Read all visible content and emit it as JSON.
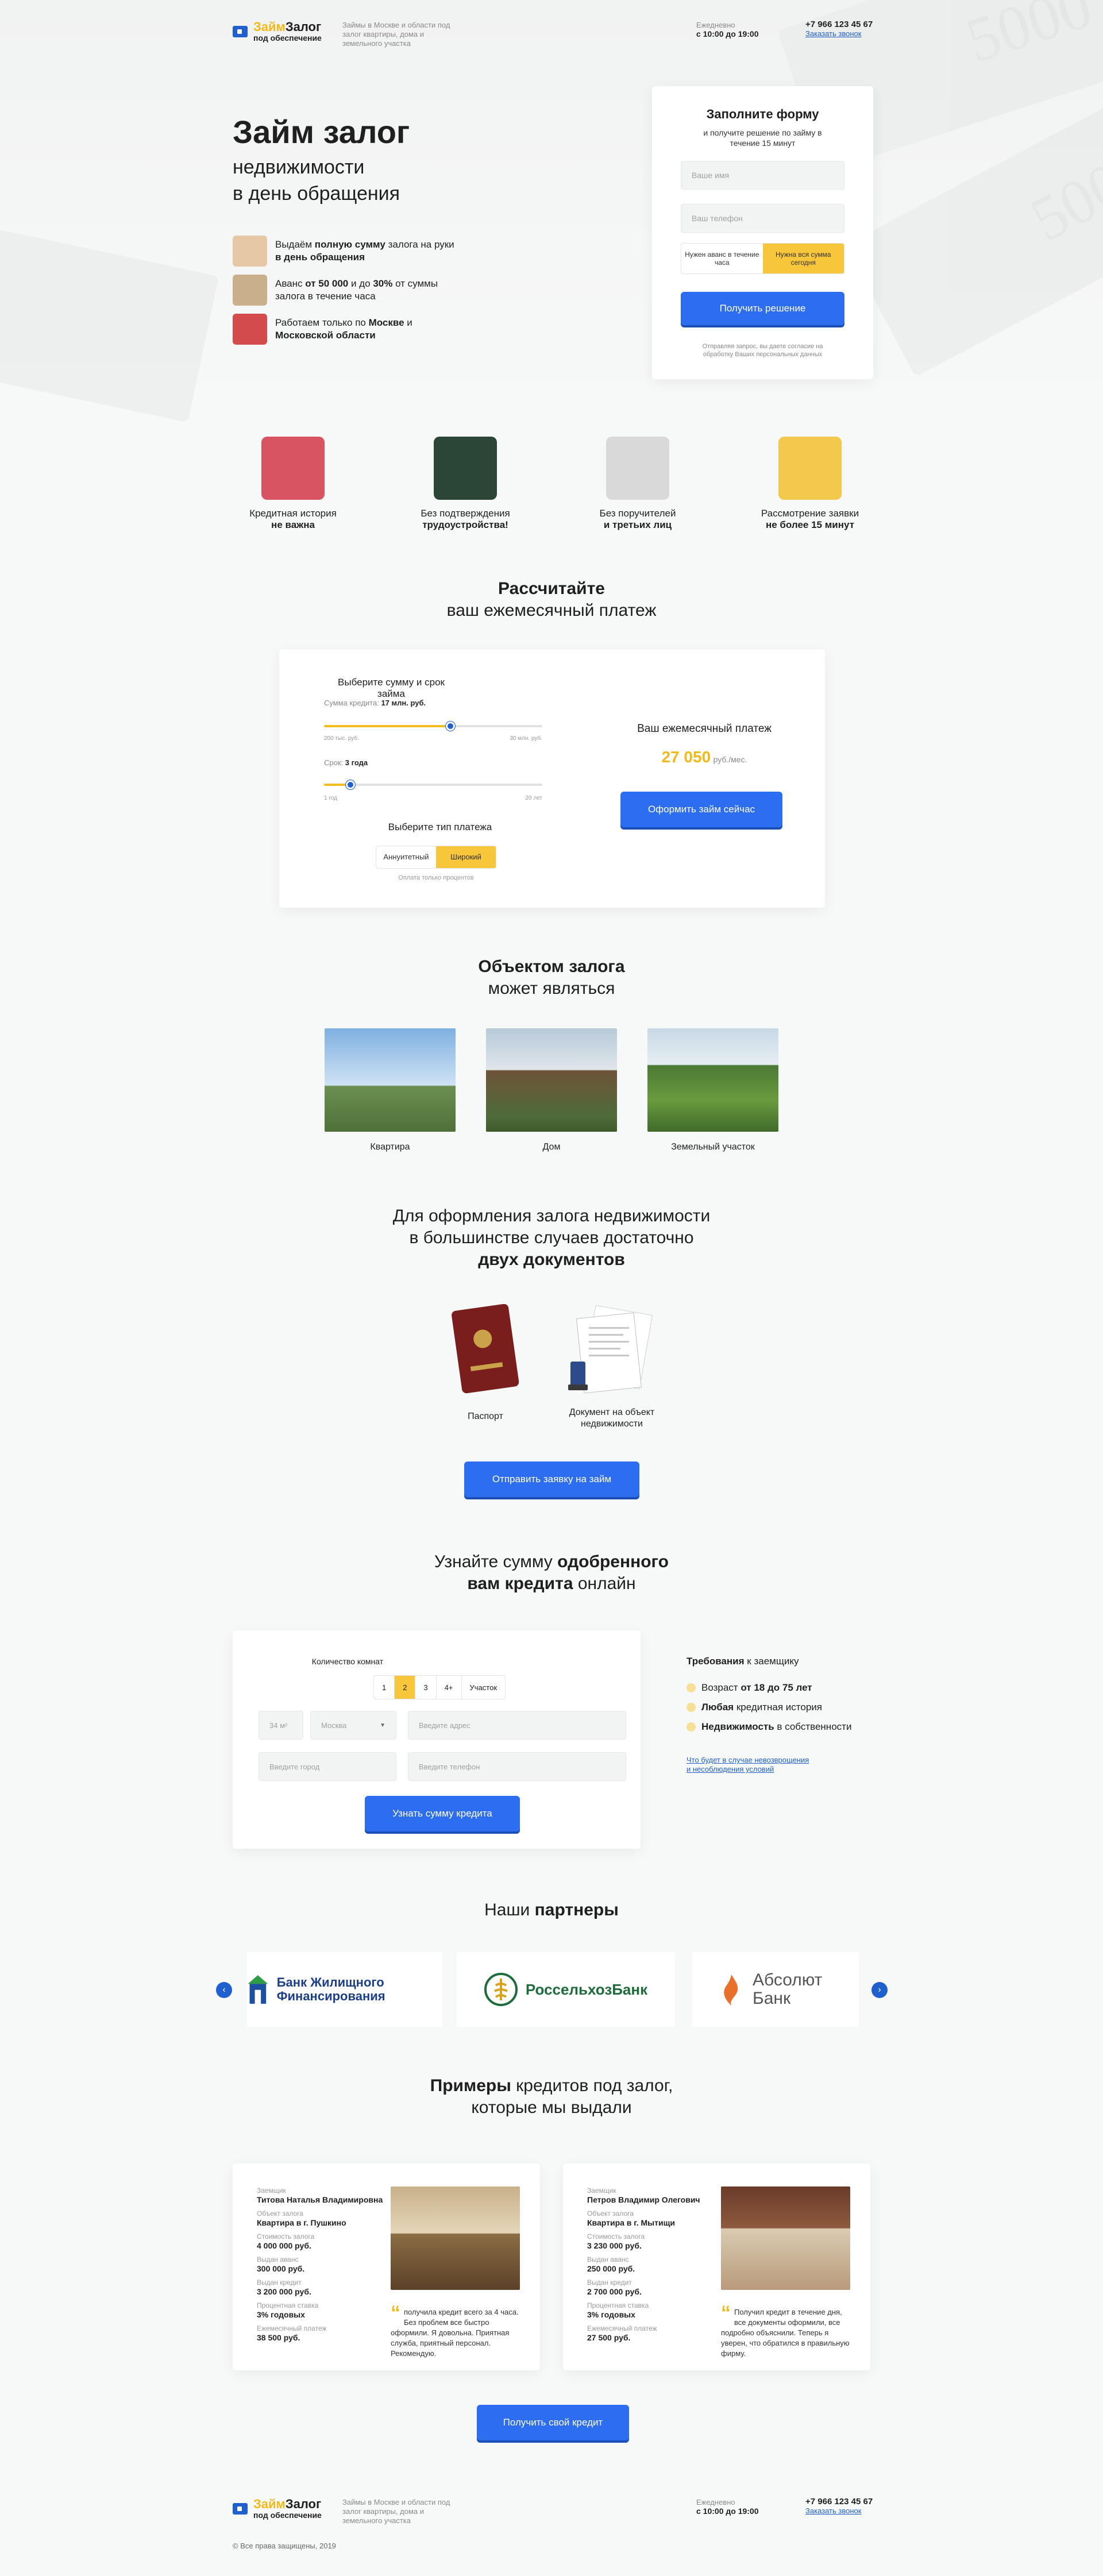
{
  "header": {
    "brand_a": "Займ",
    "brand_b": "Залог",
    "brand_sub": "под обеспечение",
    "note": "Займы в Москве и области под залог квартиры, дома и земельного участка",
    "hours_label": "Ежедневно",
    "hours": "с 10:00 до 19:00",
    "phone": "+7 966 123 45 67",
    "callback": "Заказать звонок"
  },
  "hero": {
    "title": "Займ залог",
    "subtitle_1": "недвижимости",
    "subtitle_2": "в день обращения",
    "features": [
      {
        "icon": "money-icon",
        "pre": "Выдаём ",
        "bold": "полную сумму",
        "mid": " залога на руки ",
        "bold2": "в день обращения",
        "post": ""
      },
      {
        "icon": "hourglass-icon",
        "pre": "Аванс ",
        "bold": "от 50 000",
        "mid": " и до ",
        "bold2": "30%",
        "post": " от суммы залога в течение часа"
      },
      {
        "icon": "moscow-icon",
        "pre": "Работаем  только по ",
        "bold": "Москве",
        "mid": " и ",
        "bold2": "Московской области",
        "post": ""
      }
    ]
  },
  "form": {
    "title": "Заполните форму",
    "subtitle": "и получите решение по займу в течение 15 минут",
    "name_placeholder": "Ваше имя",
    "phone_placeholder": "Ваш телефон",
    "opt1": "Нужен аванс в течение часа",
    "opt2": "Нужна вся сумма сегодня",
    "submit": "Получить решение",
    "consent": "Отправляя запрос, вы даете согласие на обработку Ваших персональных данных"
  },
  "features": [
    {
      "icon": "credit-cards-icon",
      "line1": "Кредитная история",
      "line2": "не важна"
    },
    {
      "icon": "passport-icon",
      "line1": "Без подтверждения",
      "line2": "трудоустройства!"
    },
    {
      "icon": "megaphone-icon",
      "line1": "Без поручителей",
      "line2": "и третьих лиц"
    },
    {
      "icon": "envelope-icon",
      "line1": "Рассмотрение заявки",
      "line2": "не более 15 минут"
    }
  ],
  "calc": {
    "title_b": "Рассчитайте",
    "title_r": "ваш ежемесячный платеж",
    "choose": "Выберите  сумму и срок займа",
    "sum_label": "Сумма кредита:",
    "sum_value": "17 млн. руб.",
    "sum_min": "200 тыс. руб.",
    "sum_max": "30 млн. руб.",
    "sum_fraction": 0.58,
    "term_label": "Срок:",
    "term_value": "3 года",
    "term_min": "1 год",
    "term_max": "20 лет",
    "term_fraction": 0.12,
    "type_title": "Выберите тип платежа",
    "type_a": "Аннуитетный",
    "type_b": "Широкий",
    "type_note": "Оплата только процентов",
    "monthly_label": "Ваш ежемесячный платеж",
    "monthly_value": "27 050",
    "monthly_unit": "руб./мес.",
    "cta": "Оформить займ сейчас"
  },
  "objects": {
    "title_b": "Объектом залога",
    "title_r": "может являться",
    "items": [
      "Квартира",
      "Дом",
      "Земельный участок"
    ]
  },
  "docs": {
    "line1": "Для оформления залога недвижимости",
    "line2": "в большинстве случаев достаточно",
    "line3": "двух документов",
    "items": [
      "Паспорт",
      "Документ на объект недвижимости"
    ],
    "cta": "Отправить заявку на займ"
  },
  "approval": {
    "line1_r": "Узнайте сумму ",
    "line1_b": "одобренного",
    "line2_b": "вам кредита",
    "line2_r": " онлайн",
    "rooms_label": "Количество комнат",
    "rooms": [
      "1",
      "2",
      "3",
      "4+",
      "Участок"
    ],
    "area": "34 м²",
    "city": "Москва",
    "address_ph": "Введите адрес",
    "city_ph": "Введите город",
    "phone_ph": "Введите телефон",
    "cta": "Узнать сумму кредита",
    "req_title_b": "Требования",
    "req_title_r": " к заемщику",
    "req": [
      {
        "pre": "Возраст ",
        "bold": "от 18 до 75 лет",
        "post": ""
      },
      {
        "pre": "",
        "bold": "Любая",
        "post": " кредитная история"
      },
      {
        "pre": "",
        "bold": "Недвижимость",
        "post": " в собственности"
      }
    ],
    "req_link": "Что будет в случае невозврощения и несоблюдения условий"
  },
  "partners": {
    "title_r": "Наши ",
    "title_b": "партнеры",
    "items": [
      "Банк Жилищного Финансирования",
      "РоссельхозБанк",
      "Абсолют Банк"
    ]
  },
  "examples": {
    "title_b": "Примеры",
    "title_r": " кредитов под залог,",
    "title_2": "которые мы выдали",
    "labels": [
      "Заемщик",
      "Объект залога",
      "Стоимость залога",
      "Выдан аванс",
      "Выдан кредит",
      "Процентная ставка",
      "Ежемесячный платеж"
    ],
    "cards": [
      {
        "values": [
          "Титова Наталья Владимировна",
          "Квартира в г. Пушкино",
          "4 000 000 руб.",
          "300 000 руб.",
          "3 200 000 руб.",
          "3% годовых",
          "38 500 руб."
        ],
        "quote": "получила кредит всего за 4 часа. Без проблем все быстро оформили. Я довольна. Приятная служба, приятный персонал. Рекомендую."
      },
      {
        "values": [
          "Петров Владимир Олегович",
          "Квартира в г. Мытищи",
          "3 230 000 руб.",
          "250 000 руб.",
          "2 700 000 руб.",
          "3% годовых",
          "27 500 руб."
        ],
        "quote": "Получил кредит в течение дня, все документы оформили, все подробно объяснили. Теперь я уверен, что обратился в правильную фирму."
      }
    ],
    "cta": "Получить свой кредит"
  },
  "footer": {
    "copyright": "© Все права защищены, 2019"
  },
  "colors": {
    "accent": "#2d6ef0",
    "yellow": "#f8c63a",
    "text": "#1f1f1f"
  }
}
